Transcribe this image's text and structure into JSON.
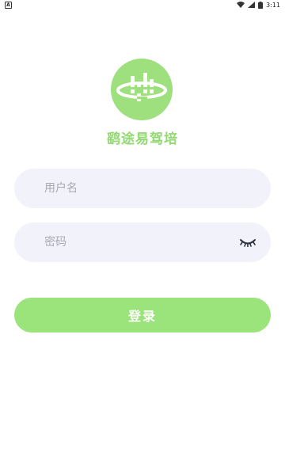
{
  "status_bar": {
    "app_indicator": "A",
    "time": "3:11",
    "icons": [
      "wifi-icon",
      "signal-icon",
      "battery-icon"
    ]
  },
  "logo": {
    "icon": "logo-icon",
    "color": "#9ee07d"
  },
  "app": {
    "title": "鹞途易驾培"
  },
  "form": {
    "username_placeholder": "用户名",
    "password_placeholder": "密码",
    "password_toggle_icon": "eye-closed-icon"
  },
  "actions": {
    "login_label": "登录"
  },
  "colors": {
    "accent": "#9be37b",
    "title": "#93d872",
    "field_bg": "#f2f3fa"
  }
}
